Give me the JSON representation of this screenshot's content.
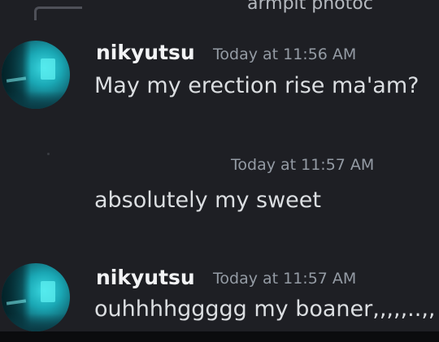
{
  "reply_preview": {
    "text": "armpit photoc"
  },
  "messages": [
    {
      "username": "nikyutsu",
      "timestamp": "Today at 11:56 AM",
      "text": "May my erection rise ma'am?"
    },
    {
      "timestamp": "Today at 11:57 AM",
      "text": "absolutely my sweet"
    },
    {
      "username": "nikyutsu",
      "timestamp": "Today at 11:57 AM",
      "text": "ouhhhhggggg my boaner,,,,,..,,"
    }
  ],
  "colors": {
    "background": "#1e1f24",
    "username": "#f2f3f5",
    "message_text": "#dbdee1",
    "timestamp": "#949ba4",
    "avatar_accent": "#1aa7b4"
  },
  "icons": [
    "reply-spine-icon",
    "avatar-image"
  ]
}
